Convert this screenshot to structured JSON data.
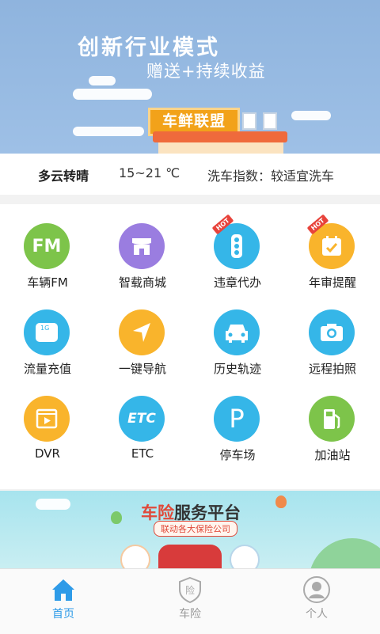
{
  "banner": {
    "headline": "创新行业模式",
    "subline": "赠送+持续收益",
    "sign": "车鲜联盟"
  },
  "weather": {
    "condition": "多云转晴",
    "temperature": "15~21 ℃",
    "wash_index": "洗车指数：较适宜洗车"
  },
  "grid": {
    "items": [
      {
        "label": "车辆FM",
        "icon": "fm-icon",
        "color": "#7dc44a",
        "hot": false
      },
      {
        "label": "智载商城",
        "icon": "store-icon",
        "color": "#9a7de0",
        "hot": false
      },
      {
        "label": "违章代办",
        "icon": "traffic-light-icon",
        "color": "#35b6e8",
        "hot": true
      },
      {
        "label": "年审提醒",
        "icon": "calendar-check-icon",
        "color": "#f9b42c",
        "hot": true
      },
      {
        "label": "流量充值",
        "icon": "sim-card-icon",
        "color": "#35b6e8",
        "hot": false
      },
      {
        "label": "一键导航",
        "icon": "navigation-arrow-icon",
        "color": "#f9b42c",
        "hot": false
      },
      {
        "label": "历史轨迹",
        "icon": "car-icon",
        "color": "#35b6e8",
        "hot": false
      },
      {
        "label": "远程拍照",
        "icon": "camera-icon",
        "color": "#35b6e8",
        "hot": false
      },
      {
        "label": "DVR",
        "icon": "video-icon",
        "color": "#f9b42c",
        "hot": false
      },
      {
        "label": "ETC",
        "icon": "etc-icon",
        "color": "#35b6e8",
        "hot": false
      },
      {
        "label": "停车场",
        "icon": "parking-icon",
        "color": "#35b6e8",
        "hot": false
      },
      {
        "label": "加油站",
        "icon": "gas-pump-icon",
        "color": "#7dc44a",
        "hot": false
      }
    ],
    "hot_badge": "HOT"
  },
  "ad": {
    "title_red": "车险",
    "title_dark": "服务平台",
    "subtitle": "联动各大保险公司"
  },
  "tabs": [
    {
      "label": "首页",
      "active": true
    },
    {
      "label": "车险",
      "active": false
    },
    {
      "label": "个人",
      "active": false
    }
  ],
  "colors": {
    "accent": "#2e9be8",
    "inactive": "#999999"
  }
}
